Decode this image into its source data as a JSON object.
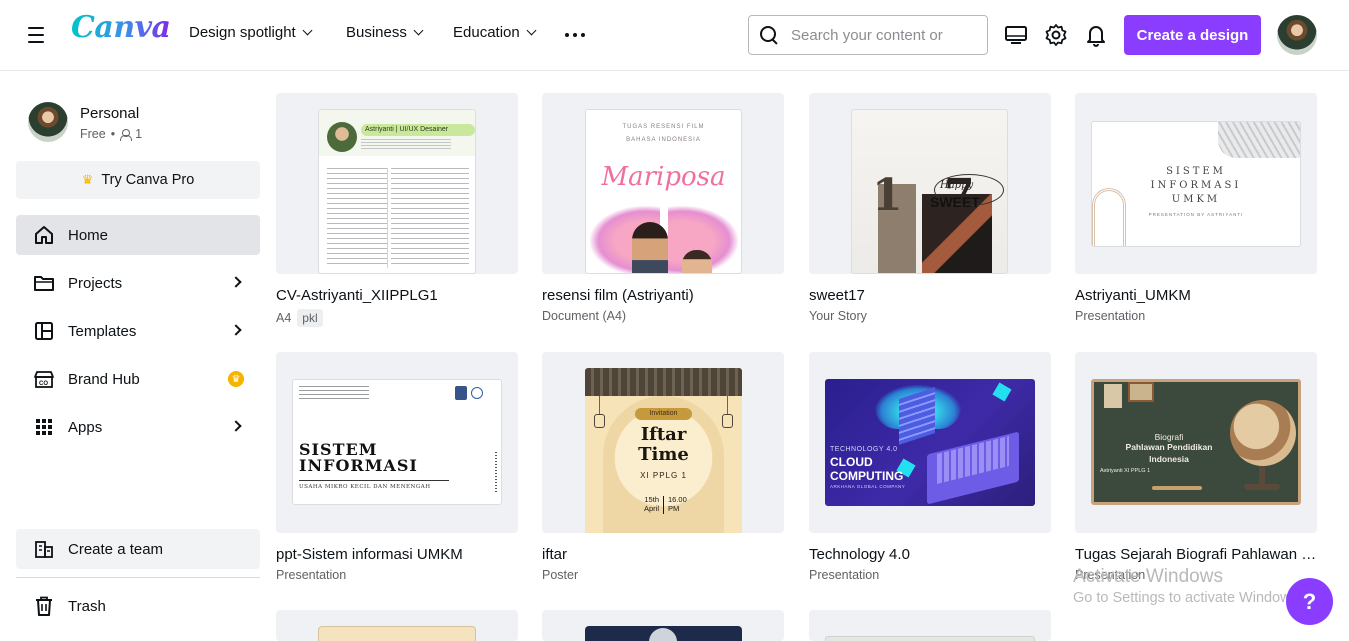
{
  "header": {
    "logo": "Canva",
    "nav": [
      {
        "label": "Design spotlight"
      },
      {
        "label": "Business"
      },
      {
        "label": "Education"
      }
    ],
    "search_placeholder": "Search your content or",
    "create_label": "Create a design"
  },
  "sidebar": {
    "profile": {
      "name": "Personal",
      "plan": "Free",
      "members": "1"
    },
    "try_pro": "Try Canva Pro",
    "items": [
      {
        "label": "Home",
        "active": true
      },
      {
        "label": "Projects"
      },
      {
        "label": "Templates"
      },
      {
        "label": "Brand Hub"
      },
      {
        "label": "Apps"
      }
    ],
    "create_team": "Create a team",
    "trash": "Trash"
  },
  "designs": [
    {
      "title": "CV-Astriyanti_XIIPPLG1",
      "type": "A4",
      "tag": "pkl"
    },
    {
      "title": "resensi film (Astriyanti)",
      "type": "Document (A4)"
    },
    {
      "title": "sweet17",
      "type": "Your Story"
    },
    {
      "title": "Astriyanti_UMKM",
      "type": "Presentation"
    },
    {
      "title": "ppt-Sistem informasi UMKM",
      "type": "Presentation"
    },
    {
      "title": "iftar",
      "type": "Poster"
    },
    {
      "title": "Technology 4.0",
      "type": "Presentation"
    },
    {
      "title": "Tugas Sejarah Biografi Pahlawan P...",
      "type": "Presentation"
    }
  ],
  "thumbs": {
    "cv": {
      "name": "Astriyanti | UI/UX Desainer"
    },
    "resensi": {
      "top1": "TUGAS RESENSI FILM",
      "top2": "BAHASA INDONESIA",
      "title": "Mariposa"
    },
    "sweet": {
      "happy": "Happy",
      "sweet": "SWEET",
      "num1": "1",
      "num2": "7"
    },
    "umkm": {
      "line1": "SISTEM",
      "line2": "INFORMASI",
      "line3": "UMKM",
      "sub": "PRESENTATION BY ASTRIYANTI"
    },
    "ppt": {
      "line1": "SISTEM",
      "line2": "INFORMASI",
      "sub": "USAHA MIKRO KECIL DAN MENENGAH"
    },
    "iftar": {
      "invite": "Invitation",
      "title1": "Iftar",
      "title2": "Time",
      "cls": "XI PPLG 1",
      "d1": "15th",
      "d2": "April",
      "t1": "16.00",
      "t2": "PM"
    },
    "tech": {
      "kicker": "TECHNOLOGY 4.0",
      "t1": "CLOUD",
      "t2": "COMPUTING",
      "company": "ARKHANA GLOBAL COMPANY"
    },
    "bio": {
      "l1": "Biografi",
      "l2": "Pahlawan Pendidikan",
      "l3": "Indonesia",
      "l4": "Astriyanti XI PPLG 1"
    }
  },
  "watermark": {
    "line1": "Activate Windows",
    "line2": "Go to Settings to activate Windows."
  },
  "help_label": "?",
  "colors": {
    "accent": "#8b3dff",
    "crown": "#f5b400"
  }
}
